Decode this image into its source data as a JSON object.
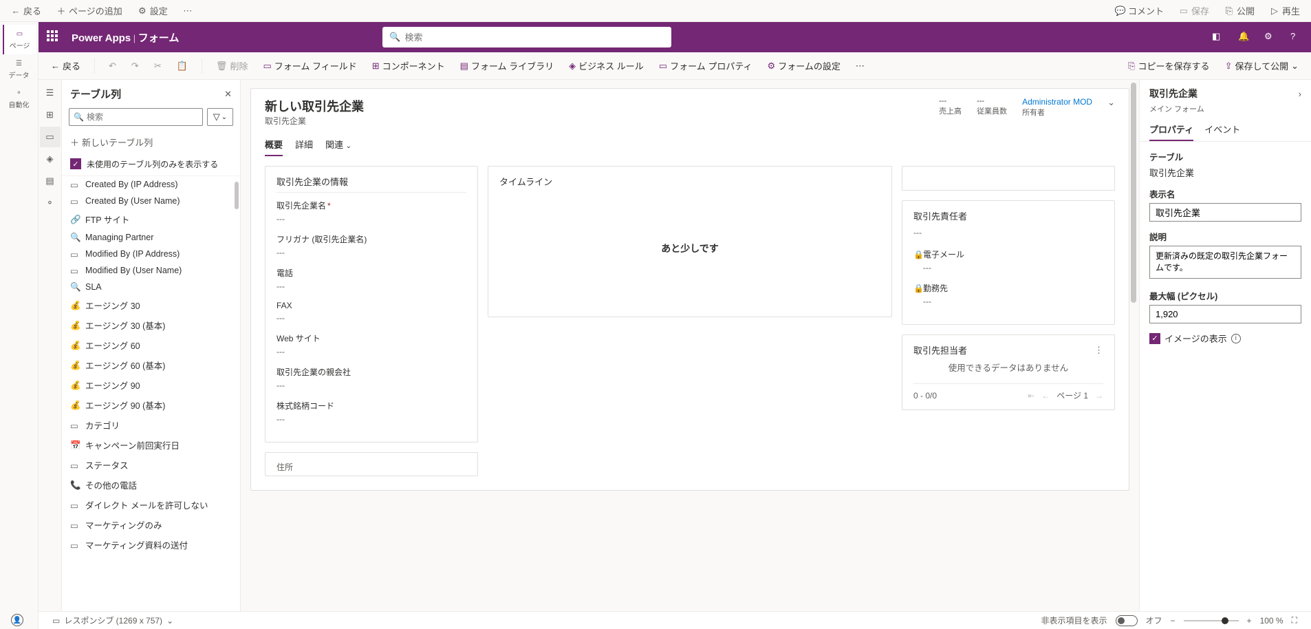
{
  "topbar": {
    "back": "戻る",
    "add_page": "ページの追加",
    "settings": "設定",
    "comment": "コメント",
    "save": "保存",
    "publish": "公開",
    "play": "再生"
  },
  "leftrail": {
    "page": "ページ",
    "data": "データ",
    "automation": "自動化"
  },
  "purple": {
    "brand": "Power Apps",
    "context": "フォーム",
    "search_ph": "検索"
  },
  "cmdbar": {
    "back": "戻る",
    "delete": "削除",
    "form_field": "フォーム フィールド",
    "component": "コンポーネント",
    "form_library": "フォーム ライブラリ",
    "business_rule": "ビジネス ルール",
    "form_property": "フォーム プロパティ",
    "form_settings": "フォームの設定",
    "save_copy": "コピーを保存する",
    "save_publish": "保存して公開"
  },
  "colpanel": {
    "title": "テーブル列",
    "search_ph": "検索",
    "new_col": "新しいテーブル列",
    "unused_only": "未使用のテーブル列のみを表示する",
    "items": [
      "Created By (IP Address)",
      "Created By (User Name)",
      "FTP サイト",
      "Managing Partner",
      "Modified By (IP Address)",
      "Modified By (User Name)",
      "SLA",
      "エージング 30",
      "エージング 30 (基本)",
      "エージング 60",
      "エージング 60 (基本)",
      "エージング 90",
      "エージング 90 (基本)",
      "カテゴリ",
      "キャンペーン前回実行日",
      "ステータス",
      "その他の電話",
      "ダイレクト メールを許可しない",
      "マーケティングのみ",
      "マーケティング資料の送付"
    ]
  },
  "form": {
    "title": "新しい取引先企業",
    "subtitle": "取引先企業",
    "head": {
      "revenue": {
        "val": "---",
        "lbl": "売上高"
      },
      "employees": {
        "val": "---",
        "lbl": "従業員数"
      },
      "owner": {
        "val": "Administrator MOD",
        "lbl": "所有者"
      }
    },
    "tabs": {
      "overview": "概要",
      "detail": "詳細",
      "related": "関連"
    },
    "sec_info": {
      "title": "取引先企業の情報",
      "fields": {
        "name": {
          "label": "取引先企業名",
          "val": "---"
        },
        "furigana": {
          "label": "フリガナ (取引先企業名)",
          "val": "---"
        },
        "phone": {
          "label": "電話",
          "val": "---"
        },
        "fax": {
          "label": "FAX",
          "val": "---"
        },
        "web": {
          "label": "Web サイト",
          "val": "---"
        },
        "parent": {
          "label": "取引先企業の親会社",
          "val": "---"
        },
        "ticker": {
          "label": "株式銘柄コード",
          "val": "---"
        },
        "address": {
          "label": "住所"
        }
      }
    },
    "sec_timeline": {
      "title": "タイムライン",
      "msg": "あと少しです"
    },
    "sec_primary": {
      "title": "取引先責任者",
      "val": "---",
      "email": {
        "label": "電子メール",
        "val": "---"
      },
      "work": {
        "label": "勤務先",
        "val": "---"
      }
    },
    "sec_contacts": {
      "title": "取引先担当者",
      "empty": "使用できるデータはありません",
      "range": "0 - 0/0",
      "page": "ページ 1"
    }
  },
  "prop": {
    "title": "取引先企業",
    "subtitle": "メイン フォーム",
    "tabs": {
      "property": "プロパティ",
      "event": "イベント"
    },
    "table_lbl": "テーブル",
    "table_val": "取引先企業",
    "display_lbl": "表示名",
    "display_val": "取引先企業",
    "desc_lbl": "説明",
    "desc_val": "更新済みの既定の取引先企業フォームです。",
    "maxw_lbl": "最大幅 (ピクセル)",
    "maxw_val": "1,920",
    "show_image": "イメージの表示"
  },
  "status": {
    "responsive": "レスポンシブ (1269 x 757)",
    "hidden": "非表示項目を表示",
    "off": "オフ",
    "zoom": "100 %"
  }
}
